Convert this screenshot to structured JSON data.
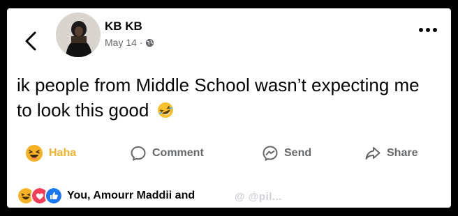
{
  "post": {
    "author": "KB KB",
    "date": "May 14 ·",
    "text": "ik people from Middle School wasn’t expecting me to look this good",
    "text_emoji": "rofl-emoji"
  },
  "actions": {
    "haha_label": "Haha",
    "comment_label": "Comment",
    "send_label": "Send",
    "share_label": "Share"
  },
  "reactions": {
    "summary": "You, Amourr Maddii and",
    "icons": [
      "haha-icon",
      "love-icon",
      "like-icon"
    ]
  },
  "watermark": "@ @pil...",
  "colors": {
    "haha": "#f7b125",
    "love": "#f33e58",
    "like": "#1877f2",
    "secondary_text": "#65676b"
  }
}
